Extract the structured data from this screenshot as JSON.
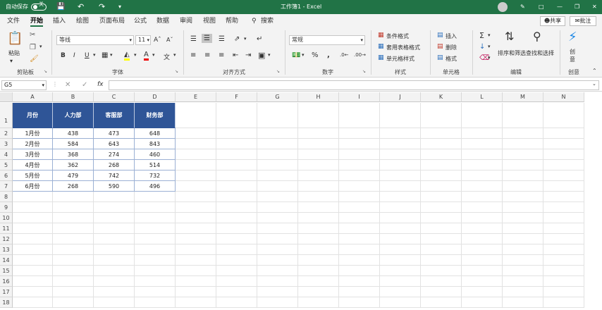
{
  "titlebar": {
    "autosave": "自动保存",
    "toggle": "关",
    "doc_title": "工作簿1 - Excel"
  },
  "menu": [
    "文件",
    "开始",
    "插入",
    "绘图",
    "页面布局",
    "公式",
    "数据",
    "审阅",
    "视图",
    "帮助"
  ],
  "search": "搜索",
  "share": "共享",
  "comments": "批注",
  "ribbon": {
    "paste": "粘贴",
    "clipboard": "剪贴板",
    "font_name": "等线",
    "font_size": "11",
    "font_group": "字体",
    "align_group": "对齐方式",
    "number_format": "常规",
    "number_group": "数字",
    "cond_format": "条件格式",
    "table_format": "套用表格格式",
    "cell_style": "单元格样式",
    "style_group": "样式",
    "insert": "插入",
    "delete": "删除",
    "format": "格式",
    "cells_group": "单元格",
    "sort_filter": "排序和筛选",
    "find_select": "查找和选择",
    "edit_group": "编辑",
    "ideas": "创意",
    "ideas_group": "创意"
  },
  "namebox": "G5",
  "columns": [
    "A",
    "B",
    "C",
    "D",
    "E",
    "F",
    "G",
    "H",
    "I",
    "J",
    "K",
    "L",
    "M",
    "N"
  ],
  "rows": [
    "1",
    "2",
    "3",
    "4",
    "5",
    "6",
    "7",
    "8",
    "9",
    "10",
    "11",
    "12",
    "13",
    "14",
    "15",
    "16",
    "17",
    "18"
  ],
  "table": {
    "headers": [
      "月份",
      "人力部",
      "客服部",
      "财务部"
    ],
    "data": [
      [
        "1月份",
        "438",
        "473",
        "648"
      ],
      [
        "2月份",
        "584",
        "643",
        "843"
      ],
      [
        "3月份",
        "368",
        "274",
        "460"
      ],
      [
        "4月份",
        "362",
        "268",
        "514"
      ],
      [
        "5月份",
        "479",
        "742",
        "732"
      ],
      [
        "6月份",
        "268",
        "590",
        "496"
      ]
    ]
  },
  "colors": {
    "excel_green": "#217346",
    "header_blue": "#2f5597"
  }
}
